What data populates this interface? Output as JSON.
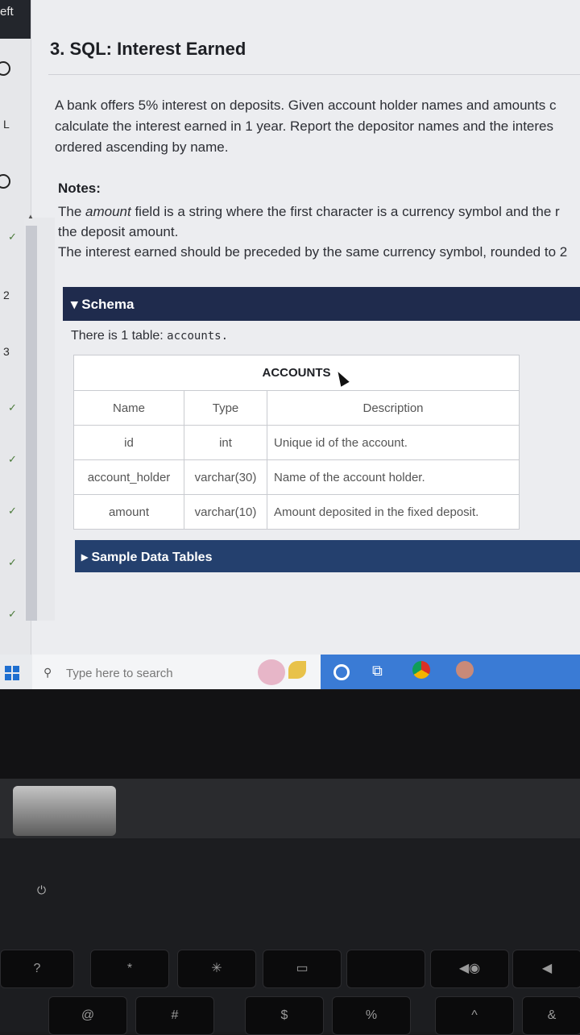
{
  "sidebar": {
    "top_label": "eft",
    "items": [
      {
        "label": "L"
      },
      {
        "label": "2"
      },
      {
        "label": "3"
      }
    ]
  },
  "problem": {
    "title": "3. SQL: Interest Earned",
    "description_lines": [
      "A bank offers 5% interest on deposits. Given account holder names and amounts c",
      "calculate the interest earned in 1 year. Report the depositor names and the interes",
      "ordered ascending by name."
    ],
    "notes_heading": "Notes:",
    "notes_lines": [
      {
        "pre": "The ",
        "em": "amount",
        "post": " field is a string where the first character is a currency symbol and the r"
      },
      {
        "pre": "the deposit amount.",
        "em": "",
        "post": ""
      },
      {
        "pre": "The interest earned should be preceded by the same currency symbol, rounded to 2",
        "em": "",
        "post": ""
      }
    ]
  },
  "schema": {
    "header": "▾ Schema",
    "intro_text": "There is 1 table: ",
    "intro_code": "accounts.",
    "table_caption": "ACCOUNTS",
    "columns": [
      "Name",
      "Type",
      "Description"
    ],
    "rows": [
      [
        "id",
        "int",
        "Unique id of the account."
      ],
      [
        "account_holder",
        "varchar(30)",
        "Name of the account holder."
      ],
      [
        "amount",
        "varchar(10)",
        "Amount deposited in the fixed deposit."
      ]
    ]
  },
  "sample": {
    "header": "▸ Sample Data Tables"
  },
  "taskbar": {
    "search_placeholder": "Type here to search"
  },
  "keyboard": {
    "keys": [
      "?",
      "*",
      "✳",
      "▭",
      "",
      "◀◉",
      "◀",
      "@",
      "#",
      "$",
      "%",
      "^",
      "&"
    ]
  }
}
